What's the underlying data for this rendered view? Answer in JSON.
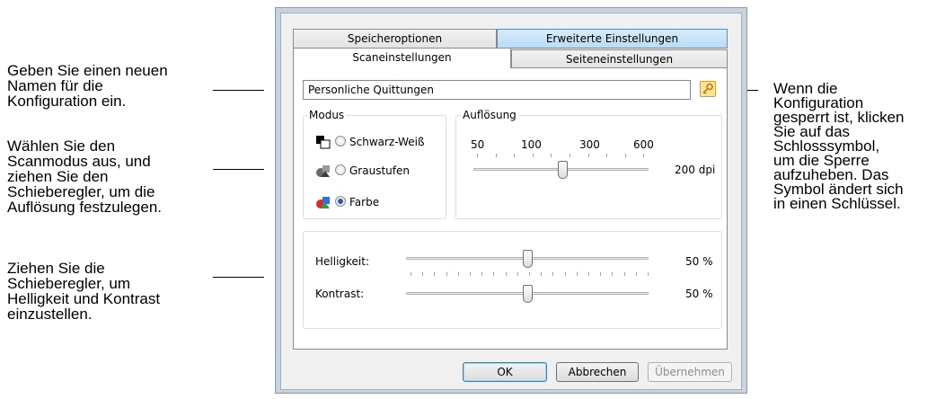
{
  "callouts": {
    "name": [
      "Geben Sie einen neuen",
      "Namen für die",
      "Konfiguration ein."
    ],
    "mode": [
      "Wählen Sie den",
      "Scanmodus aus, und",
      "ziehen Sie den",
      "Schieberegler, um die",
      "Auflösung festzulegen."
    ],
    "sliders": [
      "Ziehen Sie die",
      "Schieberegler, um",
      "Helligkeit und Kontrast",
      "einzustellen."
    ],
    "lock": [
      "Wenn die",
      "Konfiguration",
      "gesperrt ist, klicken",
      "Sie auf das",
      "Schlosssymbol,",
      "um die Sperre",
      "aufzuheben. Das",
      "Symbol ändert sich",
      "in einen Schlüssel."
    ]
  },
  "tabs": {
    "storage": "Speicheroptionen",
    "advanced": "Erweiterte Einstellungen",
    "scan": "Scaneinstellungen",
    "page": "Seiteneinstellungen"
  },
  "config_name": {
    "value": "Personliche Quittungen"
  },
  "mode": {
    "title": "Modus",
    "options": [
      {
        "label": "Schwarz-Weiß",
        "checked": false,
        "icon": "bw-mode-icon"
      },
      {
        "label": "Graustufen",
        "checked": false,
        "icon": "grayscale-mode-icon"
      },
      {
        "label": "Farbe",
        "checked": true,
        "icon": "color-mode-icon"
      }
    ]
  },
  "resolution": {
    "title": "Auflösung",
    "ticks": [
      "50",
      "100",
      "300",
      "600"
    ],
    "value_label": "200 dpi"
  },
  "adjustments": {
    "brightness": {
      "label": "Helligkeit:",
      "value_label": "50 %",
      "value": 0.5
    },
    "contrast": {
      "label": "Kontrast:",
      "value_label": "50 %",
      "value": 0.5
    }
  },
  "buttons": {
    "ok": "OK",
    "cancel": "Abbrechen",
    "apply": "Übernehmen"
  },
  "colors": {
    "tab_blue": "#b9dcf6",
    "lock_icon": "#e8a417"
  }
}
